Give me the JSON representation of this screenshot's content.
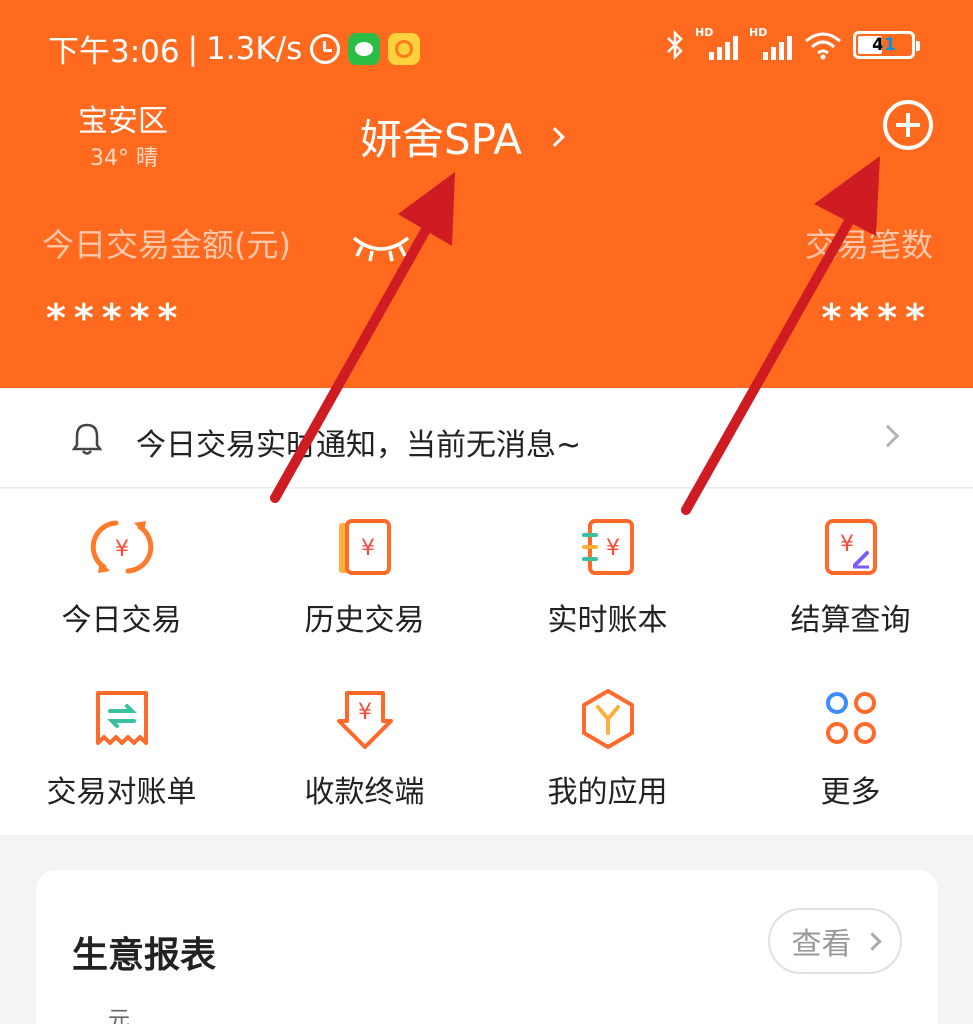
{
  "status_bar": {
    "time": "下午3:06",
    "separator": "|",
    "speed": "1.3K/s",
    "battery": "41",
    "hd_label": "HD"
  },
  "header": {
    "location": "宝安区",
    "weather": "34° 晴",
    "store_name": "妍舍SPA",
    "today_amount_label": "今日交易金额(元)",
    "today_amount_value": "*****",
    "txn_count_label": "交易笔数",
    "txn_count_value": "****"
  },
  "notice": {
    "text": "今日交易实时通知，当前无消息~"
  },
  "grid": {
    "items": [
      {
        "label": "今日交易"
      },
      {
        "label": "历史交易"
      },
      {
        "label": "实时账本"
      },
      {
        "label": "结算查询"
      },
      {
        "label": "交易对账单"
      },
      {
        "label": "收款终端"
      },
      {
        "label": "我的应用"
      },
      {
        "label": "更多"
      }
    ]
  },
  "report": {
    "title": "生意报表",
    "view_label": "查看",
    "unit": "元"
  },
  "colors": {
    "brand_orange": "#ff6a1f",
    "arrow_red": "#cf1b22"
  },
  "icons": {
    "bell": "bell-icon",
    "eye": "eye-closed-icon",
    "add": "add-circle-icon"
  }
}
